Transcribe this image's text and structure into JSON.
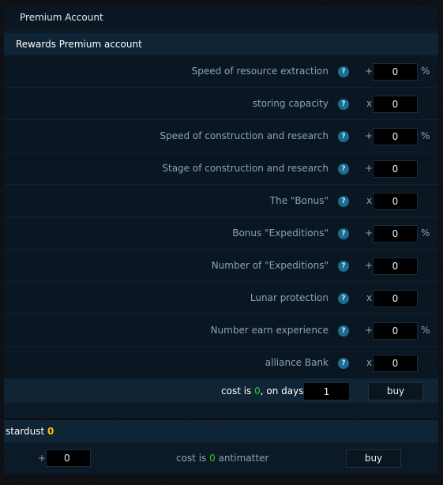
{
  "panel_title": "Premium Account",
  "section_title": "Rewards Premium account",
  "rows": [
    {
      "label": "Speed of resource extraction",
      "op": "+",
      "value": "0",
      "unit": "%"
    },
    {
      "label": "storing capacity",
      "op": "x",
      "value": "0",
      "unit": ""
    },
    {
      "label": "Speed of construction and research",
      "op": "+",
      "value": "0",
      "unit": "%"
    },
    {
      "label": "Stage of construction and research",
      "op": "+",
      "value": "0",
      "unit": ""
    },
    {
      "label": "The \"Bonus\"",
      "op": "x",
      "value": "0",
      "unit": ""
    },
    {
      "label": "Bonus \"Expeditions\"",
      "op": "+",
      "value": "0",
      "unit": "%"
    },
    {
      "label": "Number of \"Expeditions\"",
      "op": "+",
      "value": "0",
      "unit": ""
    },
    {
      "label": "Lunar protection",
      "op": "x",
      "value": "0",
      "unit": ""
    },
    {
      "label": "Number earn experience",
      "op": "+",
      "value": "0",
      "unit": "%"
    },
    {
      "label": "alliance Bank",
      "op": "x",
      "value": "0",
      "unit": ""
    }
  ],
  "help_glyph": "?",
  "cost": {
    "prefix": "cost is ",
    "amount": "0",
    "suffix": ", on days:",
    "days_value": "1",
    "buy_label": "buy"
  },
  "stardust": {
    "label": "stardust ",
    "amount": "0",
    "plus": "+",
    "input_value": "0",
    "cost_prefix": "cost is ",
    "cost_amount": "0",
    "cost_suffix": " antimatter",
    "buy_label": "buy"
  },
  "colors": {
    "positive_amount": "#2ccf2c",
    "stardust_amount": "#f2c012",
    "help_icon": "#1c6b93"
  }
}
